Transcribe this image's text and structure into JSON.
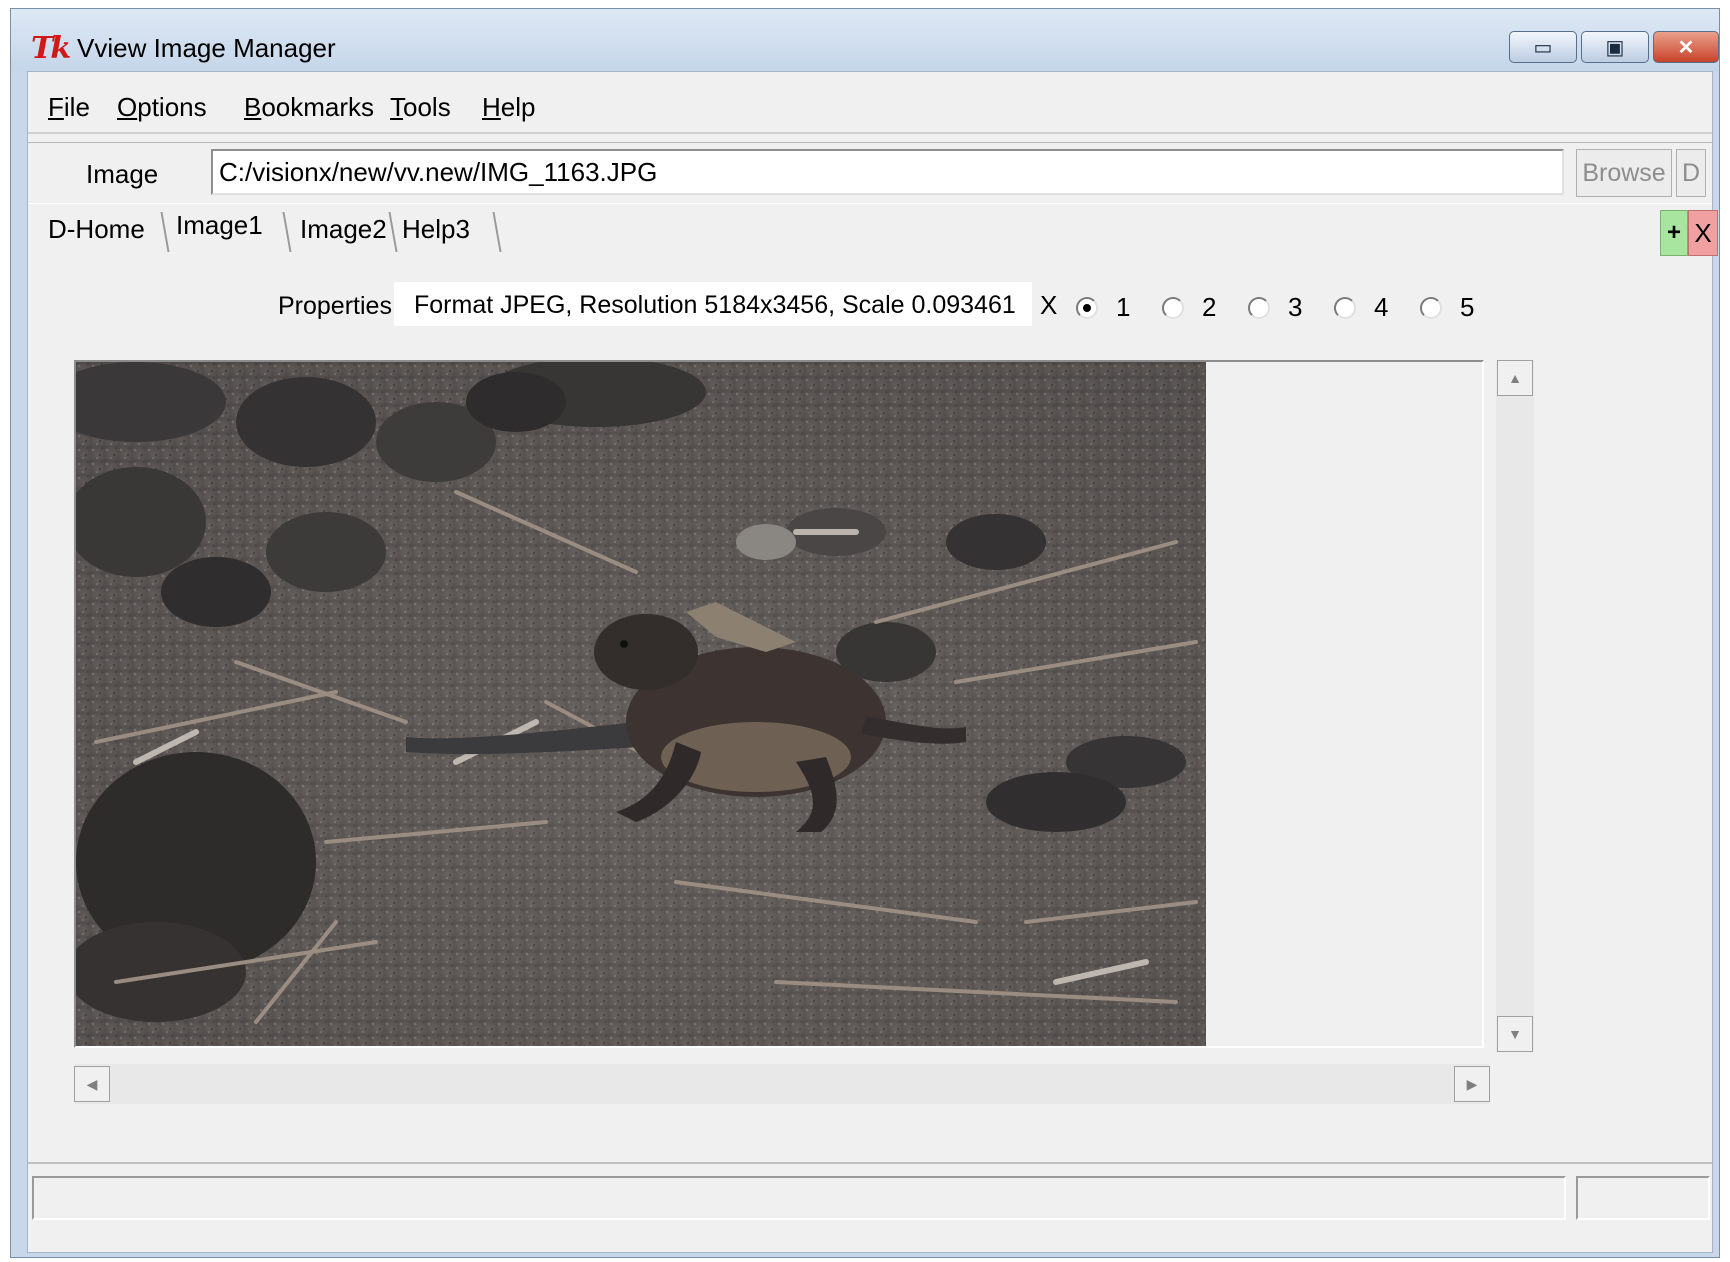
{
  "window": {
    "logo_text": "Tk",
    "title": "Vview Image Manager",
    "min_glyph": "▭",
    "max_glyph": "▣",
    "close_glyph": "✕"
  },
  "menu": [
    {
      "label": "File",
      "mnemonic": "F",
      "rest": "ile"
    },
    {
      "label": "Options",
      "mnemonic": "O",
      "rest": "ptions"
    },
    {
      "label": "Bookmarks",
      "mnemonic": "B",
      "rest": "ookmarks"
    },
    {
      "label": "Tools",
      "mnemonic": "T",
      "rest": "ools"
    },
    {
      "label": "Help",
      "mnemonic": "H",
      "rest": "elp"
    }
  ],
  "image_row": {
    "label": "Image",
    "path": "C:/visionx/new/vv.new/IMG_1163.JPG",
    "browse_label": "Browse",
    "d_label": "D"
  },
  "tabs": [
    {
      "label": "D-Home",
      "active": false
    },
    {
      "label": "Image1",
      "active": true
    },
    {
      "label": "Image2",
      "active": false
    },
    {
      "label": "Help3",
      "active": false
    }
  ],
  "tab_add_label": "+",
  "tab_close_label": "X",
  "properties": {
    "label": "Properties",
    "value": "Format JPEG, Resolution 5184x3456, Scale 0.093461",
    "x_label": "X",
    "zoom_options": [
      "1",
      "2",
      "3",
      "4",
      "5"
    ],
    "zoom_selected": "1"
  },
  "scroll_glyphs": {
    "up": "▲",
    "down": "▼",
    "left": "◀",
    "right": "▶"
  },
  "status": {
    "main": "",
    "side": ""
  }
}
